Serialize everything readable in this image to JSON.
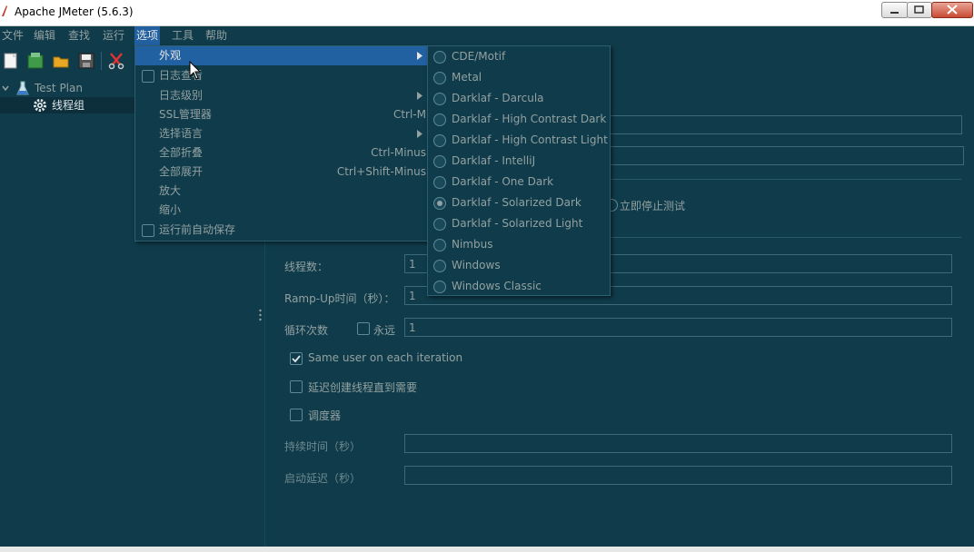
{
  "window": {
    "title": "Apache JMeter (5.6.3)"
  },
  "menubar": {
    "items": [
      "文件",
      "编辑",
      "查找",
      "运行",
      "选项",
      "工具",
      "帮助"
    ],
    "active_index": 4
  },
  "tree": {
    "items": [
      {
        "label": "Test Plan"
      },
      {
        "label": "线程组",
        "selected": true
      }
    ]
  },
  "options_menu": {
    "items": [
      {
        "label": "外观",
        "type": "submenu",
        "active": true
      },
      {
        "label": "日志查看",
        "type": "checkbox",
        "checked": false
      },
      {
        "label": "日志级别",
        "type": "submenu"
      },
      {
        "label": "SSL管理器",
        "accelerator": "Ctrl-M"
      },
      {
        "label": "选择语言",
        "type": "submenu"
      },
      {
        "label": "全部折叠",
        "accelerator": "Ctrl-Minus"
      },
      {
        "label": "全部展开",
        "accelerator": "Ctrl+Shift-Minus"
      },
      {
        "label": "放大"
      },
      {
        "label": "缩小"
      },
      {
        "label": "运行前自动保存",
        "type": "checkbox",
        "checked": false
      }
    ]
  },
  "look_and_feel_submenu": {
    "items": [
      {
        "label": "CDE/Motif",
        "checked": false
      },
      {
        "label": "Metal",
        "checked": false
      },
      {
        "label": "Darklaf - Darcula",
        "checked": false
      },
      {
        "label": "Darklaf - High Contrast Dark",
        "checked": false
      },
      {
        "label": "Darklaf - High Contrast Light",
        "checked": false
      },
      {
        "label": "Darklaf - IntelliJ",
        "checked": false
      },
      {
        "label": "Darklaf - One Dark",
        "checked": false
      },
      {
        "label": "Darklaf - Solarized Dark",
        "checked": true
      },
      {
        "label": "Darklaf - Solarized Light",
        "checked": false
      },
      {
        "label": "Nimbus",
        "checked": false
      },
      {
        "label": "Windows",
        "checked": false
      },
      {
        "label": "Windows Classic",
        "checked": false
      }
    ]
  },
  "thread_group": {
    "stop_test_now_label": "立即停止测试",
    "thread_count_label": "线程数：",
    "thread_count_value": "1",
    "ramp_up_label": "Ramp-Up时间（秒）：",
    "ramp_up_value": "1",
    "loop_label": "循环次数",
    "forever_label": "永远",
    "forever_checked": false,
    "loop_value": "1",
    "same_user_label": "Same user on each iteration",
    "same_user_checked": true,
    "delay_create_label": "延迟创建线程直到需要",
    "delay_create_checked": false,
    "scheduler_label": "调度器",
    "scheduler_checked": false,
    "duration_label": "持续时间（秒）",
    "duration_value": "",
    "startup_delay_label": "启动延迟（秒）",
    "startup_delay_value": ""
  },
  "colors": {
    "background": "#0f3b4a",
    "menu_highlight": "#2261a1",
    "text": "#93a1a1"
  }
}
